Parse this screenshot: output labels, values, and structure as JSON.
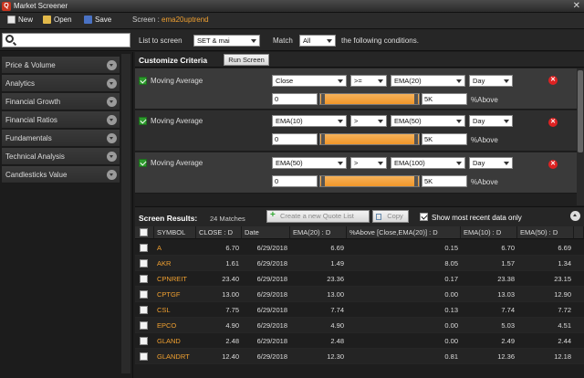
{
  "window": {
    "title": "Market Screener",
    "close_glyph": "✕"
  },
  "toolbar": {
    "new_label": "New",
    "open_label": "Open",
    "save_label": "Save",
    "screen_prefix": "Screen :",
    "screen_name": "ema20uptrend"
  },
  "filter": {
    "list_label": "List to screen",
    "list_value": "SET & mai",
    "match_label": "Match",
    "match_value": "All",
    "conditions_text": "the following conditions."
  },
  "sidebar": {
    "items": [
      {
        "label": "Price & Volume"
      },
      {
        "label": "Analytics"
      },
      {
        "label": "Financial Growth"
      },
      {
        "label": "Financial Ratios"
      },
      {
        "label": "Fundamentals"
      },
      {
        "label": "Technical Analysis"
      },
      {
        "label": "Candlesticks Value"
      }
    ]
  },
  "criteria": {
    "title": "Customize Criteria",
    "run_label": "Run Screen",
    "rows": [
      {
        "name": "Moving Average",
        "field": "Close",
        "op": ">=",
        "ref": "EMA(20)",
        "period": "Day",
        "min": "0",
        "max": "5K",
        "unit": "%Above"
      },
      {
        "name": "Moving Average",
        "field": "EMA(10)",
        "op": ">",
        "ref": "EMA(50)",
        "period": "Day",
        "min": "0",
        "max": "5K",
        "unit": "%Above"
      },
      {
        "name": "Moving Average",
        "field": "EMA(50)",
        "op": ">",
        "ref": "EMA(100)",
        "period": "Day",
        "min": "0",
        "max": "5K",
        "unit": "%Above"
      }
    ]
  },
  "results": {
    "title": "Screen Results:",
    "matches": "24 Matches",
    "create_label": "Create a new Quote List",
    "copy_label": "Copy",
    "recent_label": "Show most recent data only",
    "columns": [
      "SYMBOL",
      "CLOSE : D",
      "Date",
      "EMA(20) : D",
      "%Above [Close,EMA(20)] : D",
      "EMA(10) : D",
      "EMA(50) : D"
    ],
    "rows": [
      [
        "A",
        "6.70",
        "6/29/2018",
        "6.69",
        "0.15",
        "6.70",
        "6.69"
      ],
      [
        "AKR",
        "1.61",
        "6/29/2018",
        "1.49",
        "8.05",
        "1.57",
        "1.34"
      ],
      [
        "CPNREIT",
        "23.40",
        "6/29/2018",
        "23.36",
        "0.17",
        "23.38",
        "23.15"
      ],
      [
        "CPTGF",
        "13.00",
        "6/29/2018",
        "13.00",
        "0.00",
        "13.03",
        "12.90"
      ],
      [
        "CSL",
        "7.75",
        "6/29/2018",
        "7.74",
        "0.13",
        "7.74",
        "7.72"
      ],
      [
        "EPCO",
        "4.90",
        "6/29/2018",
        "4.90",
        "0.00",
        "5.03",
        "4.51"
      ],
      [
        "GLAND",
        "2.48",
        "6/29/2018",
        "2.48",
        "0.00",
        "2.49",
        "2.44"
      ],
      [
        "GLANDRT",
        "12.40",
        "6/29/2018",
        "12.30",
        "0.81",
        "12.36",
        "12.18"
      ]
    ]
  }
}
